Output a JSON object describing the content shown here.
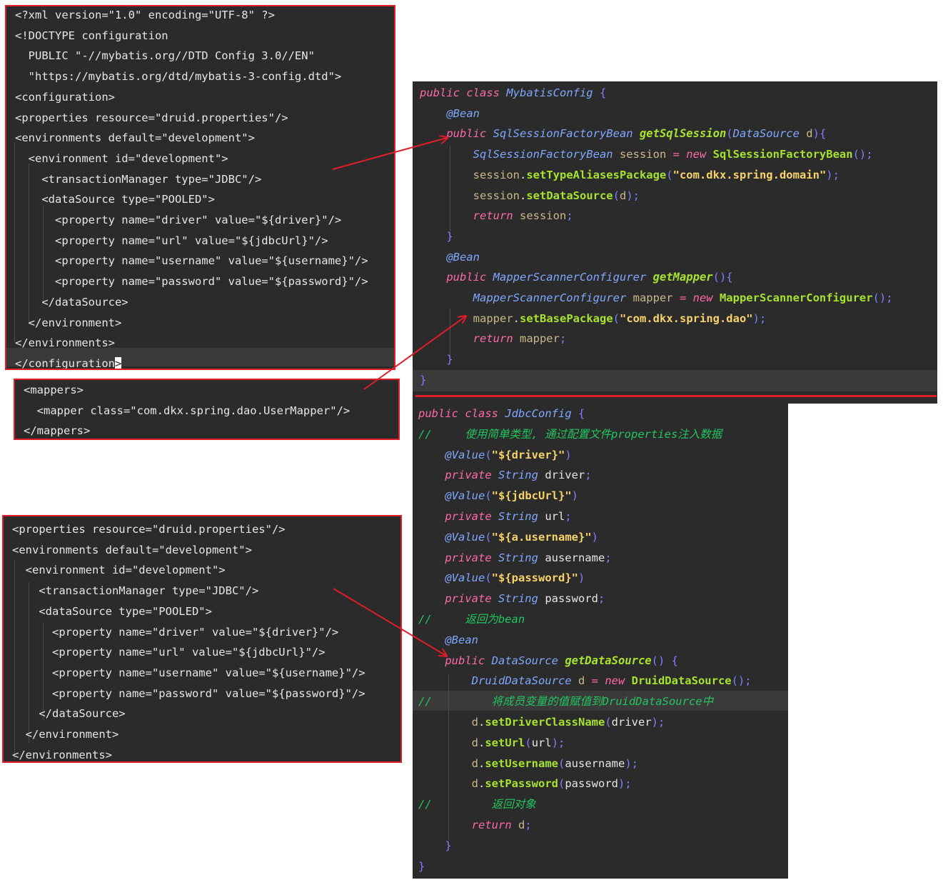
{
  "xml_config": {
    "lines": [
      "<?xml version=\"1.0\" encoding=\"UTF-8\" ?>",
      "<!DOCTYPE configuration",
      "  PUBLIC \"-//mybatis.org//DTD Config 3.0//EN\"",
      "  \"https://mybatis.org/dtd/mybatis-3-config.dtd\">",
      "<configuration>",
      "<properties resource=\"druid.properties\"/>",
      "<environments default=\"development\">",
      "  <environment id=\"development\">",
      "    <transactionManager type=\"JDBC\"/>",
      "    <dataSource type=\"POOLED\">",
      "      <property name=\"driver\" value=\"${driver}\"/>",
      "      <property name=\"url\" value=\"${jdbcUrl}\"/>",
      "      <property name=\"username\" value=\"${username}\"/>",
      "      <property name=\"password\" value=\"${password}\"/>",
      "    </dataSource>",
      "  </environment>",
      "</environments>",
      "</configuration"
    ],
    "last_line_cursor": ">"
  },
  "xml_mappers": {
    "lines": [
      "<mappers>",
      "  <mapper class=\"com.dkx.spring.dao.UserMapper\"/>",
      "</mappers>"
    ]
  },
  "xml_environments": {
    "lines": [
      "<properties resource=\"druid.properties\"/>",
      "<environments default=\"development\">",
      "  <environment id=\"development\">",
      "    <transactionManager type=\"JDBC\"/>",
      "    <dataSource type=\"POOLED\">",
      "      <property name=\"driver\" value=\"${driver}\"/>",
      "      <property name=\"url\" value=\"${jdbcUrl}\"/>",
      "      <property name=\"username\" value=\"${username}\"/>",
      "      <property name=\"password\" value=\"${password}\"/>",
      "    </dataSource>",
      "  </environment>",
      "</environments>"
    ]
  },
  "mybatis_config": {
    "lines": [
      [
        [
          "public class ",
          "kw"
        ],
        [
          "MybatisConfig ",
          "type"
        ],
        [
          "{",
          "p"
        ]
      ],
      [
        [
          "    @Bean",
          "anno"
        ]
      ],
      [
        [
          "    public ",
          "kw"
        ],
        [
          "SqlSessionFactoryBean ",
          "type"
        ],
        [
          "getSqlSession",
          "fnd"
        ],
        [
          "(",
          "p"
        ],
        [
          "DataSource ",
          "type"
        ],
        [
          "d",
          "var"
        ],
        [
          "){",
          "p"
        ]
      ],
      [
        [
          "        SqlSessionFactoryBean ",
          "type"
        ],
        [
          "session ",
          "var"
        ],
        [
          "= ",
          "op"
        ],
        [
          "new ",
          "kw"
        ],
        [
          "SqlSessionFactoryBean",
          "fn"
        ],
        [
          "();",
          "p"
        ]
      ],
      [
        [
          "        session",
          "var"
        ],
        [
          ".",
          "plain"
        ],
        [
          "setTypeAliasesPackage",
          "fn"
        ],
        [
          "(",
          "p"
        ],
        [
          "\"com.dkx.spring.domain\"",
          "str"
        ],
        [
          ");",
          "p"
        ]
      ],
      [
        [
          "        session",
          "var"
        ],
        [
          ".",
          "plain"
        ],
        [
          "setDataSource",
          "fn"
        ],
        [
          "(",
          "p"
        ],
        [
          "d",
          "var"
        ],
        [
          ");",
          "p"
        ]
      ],
      [
        [
          "        return ",
          "kw"
        ],
        [
          "session",
          "var"
        ],
        [
          ";",
          "p"
        ]
      ],
      [
        [
          "    }",
          "p"
        ]
      ],
      [
        [
          "    @Bean",
          "anno"
        ]
      ],
      [
        [
          "    public ",
          "kw"
        ],
        [
          "MapperScannerConfigurer ",
          "type"
        ],
        [
          "getMapper",
          "fnd"
        ],
        [
          "(){",
          "p"
        ]
      ],
      [
        [
          "        MapperScannerConfigurer ",
          "type"
        ],
        [
          "mapper ",
          "var"
        ],
        [
          "= ",
          "op"
        ],
        [
          "new ",
          "kw"
        ],
        [
          "MapperScannerConfigurer",
          "fn"
        ],
        [
          "();",
          "p"
        ]
      ],
      [
        [
          "        mapper",
          "var"
        ],
        [
          ".",
          "plain"
        ],
        [
          "setBasePackage",
          "fn"
        ],
        [
          "(",
          "p"
        ],
        [
          "\"com.dkx.spring.dao\"",
          "str"
        ],
        [
          ");",
          "p"
        ]
      ],
      [
        [
          "        return ",
          "kw"
        ],
        [
          "mapper",
          "var"
        ],
        [
          ";",
          "p"
        ]
      ],
      [
        [
          "    }",
          "p"
        ]
      ],
      [
        [
          "}",
          "p"
        ]
      ]
    ]
  },
  "jdbc_config": {
    "lines": [
      [
        [
          "public class ",
          "kw"
        ],
        [
          "JdbcConfig ",
          "type"
        ],
        [
          "{",
          "p"
        ]
      ],
      [
        [
          "//     使用简单类型, 通过配置文件properties注入数据",
          "cm"
        ]
      ],
      [
        [
          "    @Value",
          "anno"
        ],
        [
          "(",
          "p"
        ],
        [
          "\"${driver}\"",
          "str"
        ],
        [
          ")",
          "p"
        ]
      ],
      [
        [
          "    private ",
          "kw"
        ],
        [
          "String ",
          "type"
        ],
        [
          "driver",
          "plain"
        ],
        [
          ";",
          "p"
        ]
      ],
      [
        [
          "    @Value",
          "anno"
        ],
        [
          "(",
          "p"
        ],
        [
          "\"${jdbcUrl}\"",
          "str"
        ],
        [
          ")",
          "p"
        ]
      ],
      [
        [
          "    private ",
          "kw"
        ],
        [
          "String ",
          "type"
        ],
        [
          "url",
          "plain"
        ],
        [
          ";",
          "p"
        ]
      ],
      [
        [
          "    @Value",
          "anno"
        ],
        [
          "(",
          "p"
        ],
        [
          "\"${a.username}\"",
          "str"
        ],
        [
          ")",
          "p"
        ]
      ],
      [
        [
          "    private ",
          "kw"
        ],
        [
          "String ",
          "type"
        ],
        [
          "ausername",
          "plain"
        ],
        [
          ";",
          "p"
        ]
      ],
      [
        [
          "    @Value",
          "anno"
        ],
        [
          "(",
          "p"
        ],
        [
          "\"${password}\"",
          "str"
        ],
        [
          ")",
          "p"
        ]
      ],
      [
        [
          "    private ",
          "kw"
        ],
        [
          "String ",
          "type"
        ],
        [
          "password",
          "plain"
        ],
        [
          ";",
          "p"
        ]
      ],
      [
        [
          "//     返回为bean",
          "cm"
        ]
      ],
      [
        [
          "    @Bean",
          "anno"
        ]
      ],
      [
        [
          "    public ",
          "kw"
        ],
        [
          "DataSource ",
          "type"
        ],
        [
          "getDataSource",
          "fnd"
        ],
        [
          "() {",
          "p"
        ]
      ],
      [
        [
          "        DruidDataSource ",
          "type"
        ],
        [
          "d ",
          "var"
        ],
        [
          "= ",
          "op"
        ],
        [
          "new ",
          "kw"
        ],
        [
          "DruidDataSource",
          "fn"
        ],
        [
          "();",
          "p"
        ]
      ],
      [
        [
          "//         将成员变量的值赋值到DruidDataSource中",
          "cm"
        ]
      ],
      [
        [
          "        d",
          "var"
        ],
        [
          ".",
          "plain"
        ],
        [
          "setDriverClassName",
          "fn"
        ],
        [
          "(",
          "p"
        ],
        [
          "driver",
          "plain"
        ],
        [
          ");",
          "p"
        ]
      ],
      [
        [
          "        d",
          "var"
        ],
        [
          ".",
          "plain"
        ],
        [
          "setUrl",
          "fn"
        ],
        [
          "(",
          "p"
        ],
        [
          "url",
          "plain"
        ],
        [
          ");",
          "p"
        ]
      ],
      [
        [
          "        d",
          "var"
        ],
        [
          ".",
          "plain"
        ],
        [
          "setUsername",
          "fn"
        ],
        [
          "(",
          "p"
        ],
        [
          "ausername",
          "plain"
        ],
        [
          ");",
          "p"
        ]
      ],
      [
        [
          "        d",
          "var"
        ],
        [
          ".",
          "plain"
        ],
        [
          "setPassword",
          "fn"
        ],
        [
          "(",
          "p"
        ],
        [
          "password",
          "plain"
        ],
        [
          ");",
          "p"
        ]
      ],
      [
        [
          "//         返回对象",
          "cm"
        ]
      ],
      [
        [
          "        return ",
          "kw"
        ],
        [
          "d",
          "var"
        ],
        [
          ";",
          "p"
        ]
      ],
      [
        [
          "    }",
          "p"
        ]
      ],
      [
        [
          "}",
          "p"
        ]
      ]
    ]
  },
  "colors": {
    "panel_bg": "#2b2b2b",
    "frame_red": "#e01e2a",
    "arrow_red": "#e01e2a"
  }
}
